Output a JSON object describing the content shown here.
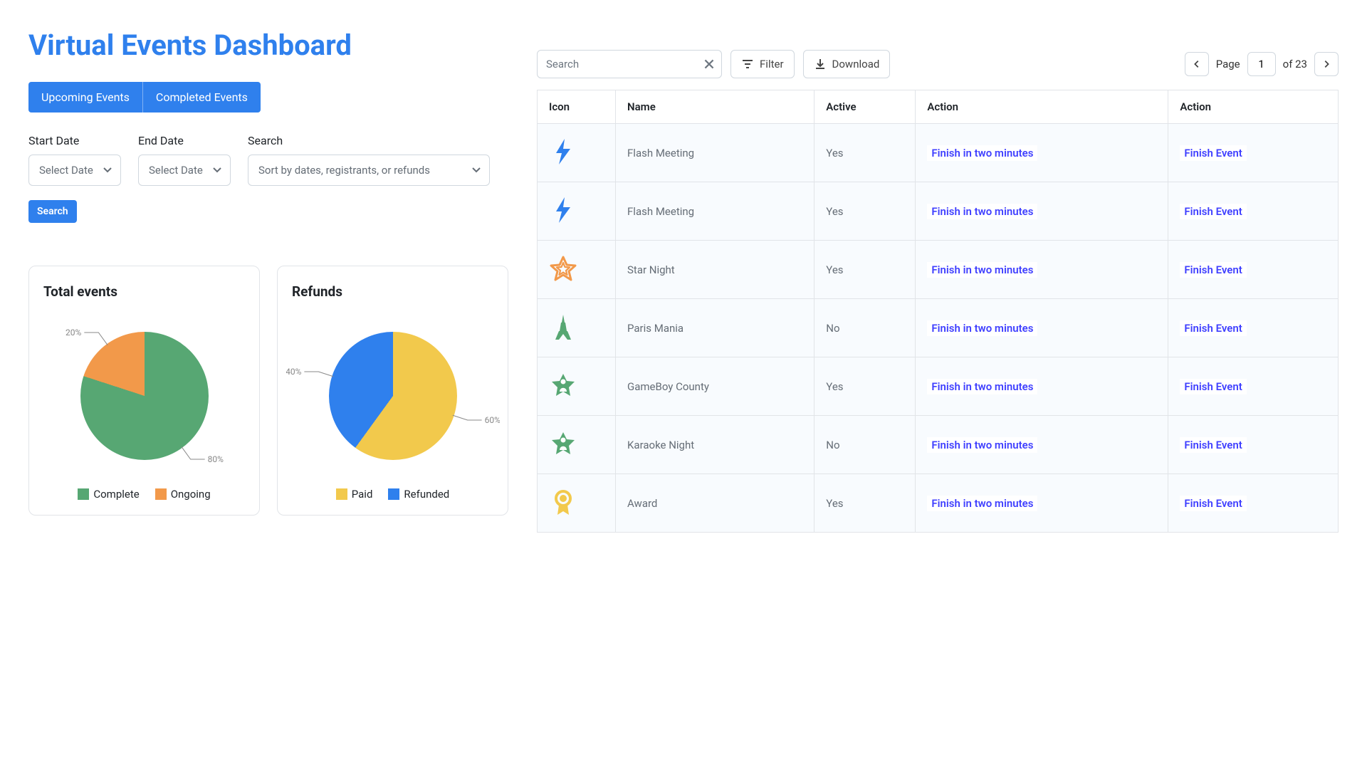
{
  "title": "Virtual Events Dashboard",
  "tabs": {
    "upcoming": "Upcoming Events",
    "completed": "Completed Events"
  },
  "filters": {
    "start_label": "Start Date",
    "end_label": "End Date",
    "search_label": "Search",
    "date_placeholder": "Select Date",
    "sort_placeholder": "Sort by dates, registrants, or refunds",
    "search_btn": "Search"
  },
  "chart_data": [
    {
      "type": "pie",
      "title": "Total events",
      "values": [
        80,
        20
      ],
      "categories": [
        "Complete",
        "Ongoing"
      ],
      "colors": [
        "#57a773",
        "#f2994a"
      ],
      "labels": [
        "80%",
        "20%"
      ]
    },
    {
      "type": "pie",
      "title": "Refunds",
      "values": [
        60,
        40
      ],
      "categories": [
        "Paid",
        "Refunded"
      ],
      "colors": [
        "#f2c94c",
        "#2f80ed"
      ],
      "labels": [
        "60%",
        "40%"
      ]
    }
  ],
  "table": {
    "search_placeholder": "Search",
    "filter_label": "Filter",
    "download_label": "Download",
    "page_label": "Page",
    "page_current": "1",
    "page_total": "of 23",
    "columns": [
      "Icon",
      "Name",
      "Active",
      "Action",
      "Action"
    ],
    "action_primary": "Finish in two minutes",
    "action_secondary": "Finish Event",
    "rows": [
      {
        "icon": "bolt",
        "name": "Flash Meeting",
        "active": "Yes"
      },
      {
        "icon": "bolt",
        "name": "Flash Meeting",
        "active": "Yes"
      },
      {
        "icon": "star",
        "name": "Star Night",
        "active": "Yes"
      },
      {
        "icon": "eiffel",
        "name": "Paris Mania",
        "active": "No"
      },
      {
        "icon": "person-star",
        "name": "GameBoy County",
        "active": "Yes"
      },
      {
        "icon": "person-star",
        "name": "Karaoke Night",
        "active": "No"
      },
      {
        "icon": "award",
        "name": "Award",
        "active": "Yes"
      }
    ]
  },
  "colors": {
    "primary": "#2f80ed",
    "green": "#57a773",
    "orange": "#f2994a",
    "yellow": "#f2c94c",
    "blue": "#2f80ed",
    "link": "#4040ff"
  }
}
